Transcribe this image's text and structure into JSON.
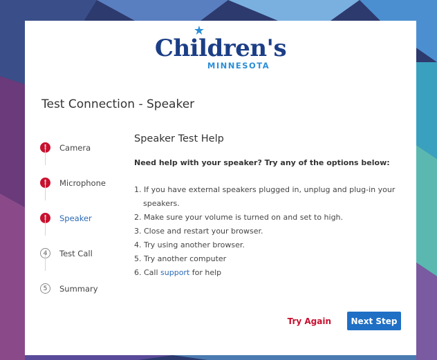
{
  "logo": {
    "brand": "Children's",
    "sub": "MINNESOTA",
    "star_glyph": "★"
  },
  "page_title": "Test Connection - Speaker",
  "steps": [
    {
      "label": "Camera",
      "status": "error",
      "marker": "!"
    },
    {
      "label": "Microphone",
      "status": "error",
      "marker": "!"
    },
    {
      "label": "Speaker",
      "status": "error-active",
      "marker": "!"
    },
    {
      "label": "Test Call",
      "status": "pending",
      "marker": "4"
    },
    {
      "label": "Summary",
      "status": "pending",
      "marker": "5"
    }
  ],
  "help": {
    "title": "Speaker Test Help",
    "intro": "Need help with your speaker? Try any of the options below:",
    "items": [
      {
        "line1": "1. If you have external speakers plugged in, unplug and plug-in your",
        "line2": "speakers."
      },
      {
        "line1": "2. Make sure your volume is turned on and set to high."
      },
      {
        "line1": "3. Close and restart your browser."
      },
      {
        "line1": "4. Try using another browser."
      },
      {
        "line1": "5. Try another computer"
      },
      {
        "prefix": "6. Call ",
        "link": "support",
        "suffix": " for help"
      }
    ]
  },
  "actions": {
    "try_again": "Try Again",
    "next_step": "Next Step"
  },
  "colors": {
    "brand_navy": "#1b3e86",
    "brand_blue": "#2b8ed8",
    "error_red": "#c8102e",
    "link_blue": "#2b6ab6",
    "primary_button": "#1f6fc5"
  }
}
